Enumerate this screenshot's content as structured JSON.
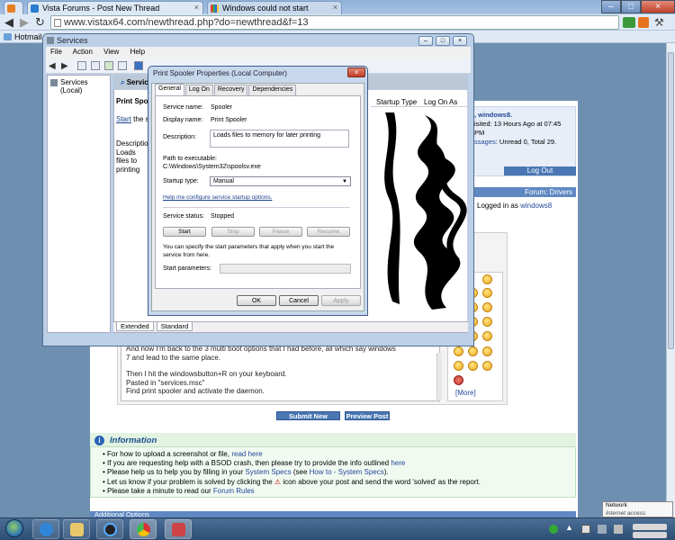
{
  "browser": {
    "tabs": [
      {
        "title": "Vista Forums - Post New Thread"
      },
      {
        "title": "Windows could not start"
      }
    ],
    "address": "www.vistax64.com/newthread.php?do=newthread&f=13",
    "bookmark": "Hotmail"
  },
  "forum": {
    "user_line1": ", windows8.",
    "user_line2": "isited: 13 Hours Ago at 07:45 PM",
    "user_line3_link": "ssages",
    "user_line3_text": ": Unread 0, Total 29.",
    "logout": "Log Out",
    "forum_bar": "Forum: Drivers",
    "logged_in_prefix": "Logged in as",
    "logged_in_user": "windows8",
    "post_lines": [
      "And now I'm back to the 3 multi boot options that I had before, all which say windows",
      "7 and lead to the same place.",
      "",
      "Then I hit the windowsbutton+R on your keyboard.",
      "Pasted in \"services.msc\"",
      "Find print spooler and activate the daemon."
    ],
    "more": "[More]",
    "submit": "Submit New Thread",
    "preview": "Preview Post",
    "info_title": "Information",
    "info": [
      {
        "text": "For how to upload a screenshot or file, ",
        "link": "read here"
      },
      {
        "text": "If you are requesting help with a BSOD crash, then please try to provide the info outlined ",
        "link": "here"
      },
      {
        "text": "Please help us to help you by filling in your ",
        "link": "System Specs",
        "mid": " (see ",
        "link2": "How to - System Specs",
        "end": ")."
      },
      {
        "text": "Let us know if your problem is solved by clicking the",
        "end": "icon above your post and send the word 'solved' as the report."
      },
      {
        "text": "Please take a minute to read our ",
        "link": "Forum Rules"
      }
    ],
    "additional": "Additional Options"
  },
  "services": {
    "title": "Services",
    "menu": [
      "File",
      "Action",
      "View",
      "Help"
    ],
    "tree_item": "Services (Local)",
    "panel_header": "Servic",
    "selected_name": "Print Spo",
    "start_link_prefix": "",
    "start_link": "Start",
    "start_link_suffix": "the se",
    "description_label": "Description",
    "description_text": "Loads files to printing",
    "col_startup": "Startup Type",
    "col_logon": "Log On As",
    "bottom_tabs": [
      "Extended",
      "Standard"
    ]
  },
  "dialog": {
    "title": "Print Spooler Properties (Local Computer)",
    "tabs": [
      "General",
      "Log On",
      "Recovery",
      "Dependencies"
    ],
    "service_name_label": "Service name:",
    "service_name": "Spooler",
    "display_name_label": "Display name:",
    "display_name": "Print Spooler",
    "description_label": "Description:",
    "description": "Loads files to memory for later printing",
    "path_label": "Path to executable:",
    "path": "C:\\Windows\\System32\\spoolsv.exe",
    "startup_label": "Startup type:",
    "startup_value": "Manual",
    "help_link": "Help me configure service startup options.",
    "status_label": "Service status:",
    "status_value": "Stopped",
    "buttons": [
      "Start",
      "Stop",
      "Pause",
      "Resume"
    ],
    "note": "You can specify the start parameters that apply when you start the service from here.",
    "params_label": "Start parameters:",
    "ok": "OK",
    "cancel": "Cancel",
    "apply": "Apply"
  },
  "tray": {
    "network_title": "Network",
    "network_status": "Internet access"
  }
}
